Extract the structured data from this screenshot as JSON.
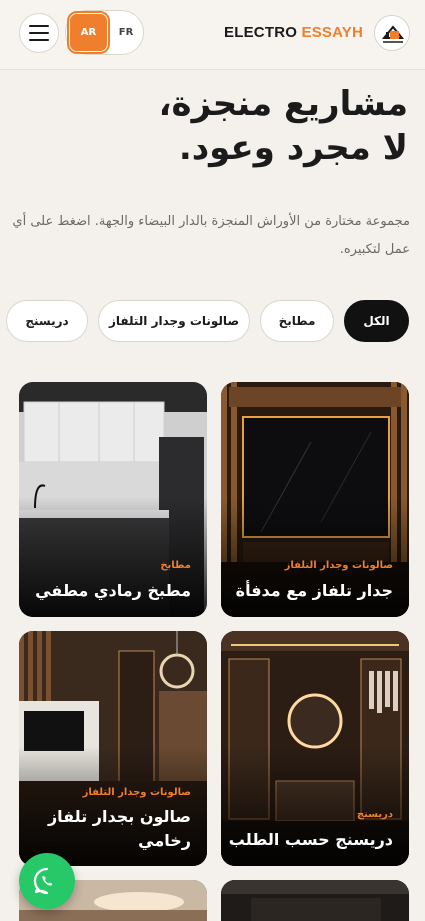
{
  "header": {
    "brand_part1": "ELECTRO",
    "brand_part2": "ESSAYH",
    "lang_active": "AR",
    "lang_other": "FR"
  },
  "hero": {
    "title_line1": "مشاريع منجزة،",
    "title_line2": "لا مجرد وعود.",
    "subtitle": "مجموعة مختارة من الأوراش المنجزة بالدار البيضاء والجهة. اضغط على أي عمل لتكبيره."
  },
  "filters": [
    {
      "label": "الكل",
      "active": true
    },
    {
      "label": "مطابخ",
      "active": false
    },
    {
      "label": "صالونات وجدار التلفاز",
      "active": false
    },
    {
      "label": "دريسنج",
      "active": false
    }
  ],
  "projects": [
    {
      "category": "صالونات وجدار التلفاز",
      "name": "جدار تلفاز مع مدفأة"
    },
    {
      "category": "مطابخ",
      "name": "مطبخ رمادي مطفي"
    },
    {
      "category": "دريسنج",
      "name": "دريسنج حسب الطلب"
    },
    {
      "category": "صالونات وجدار التلفاز",
      "name": "صالون بجدار تلفاز رخامي"
    }
  ],
  "colors": {
    "accent": "#ef7f2d",
    "active_chip": "#111111",
    "whatsapp": "#27c867",
    "background": "#f4f1ec"
  },
  "icons": [
    "menu-icon",
    "brand-logo",
    "whatsapp-icon"
  ]
}
